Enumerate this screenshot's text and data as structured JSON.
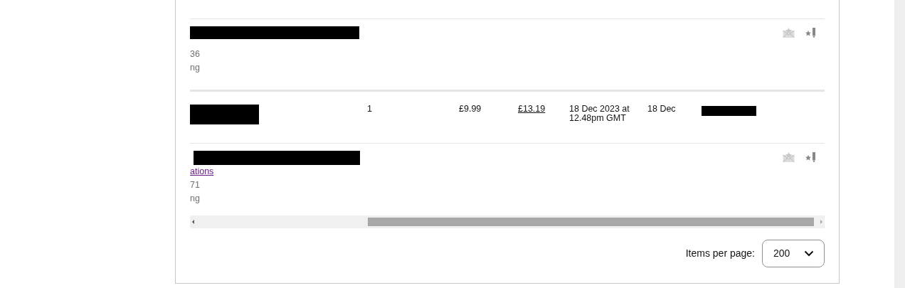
{
  "rows": [
    {
      "kind": "detail",
      "lines": [
        "36",
        "ng"
      ]
    },
    {
      "kind": "order",
      "quantity": "1",
      "price": "£9.99",
      "total": "£13.19",
      "date": "18 Dec 2023 at 12.48pm GMT",
      "dispatch": "18 Dec"
    },
    {
      "kind": "detail",
      "link": "ations",
      "lines": [
        "71",
        "ng"
      ]
    }
  ],
  "pagination": {
    "label": "Items per page:",
    "value": "200"
  }
}
